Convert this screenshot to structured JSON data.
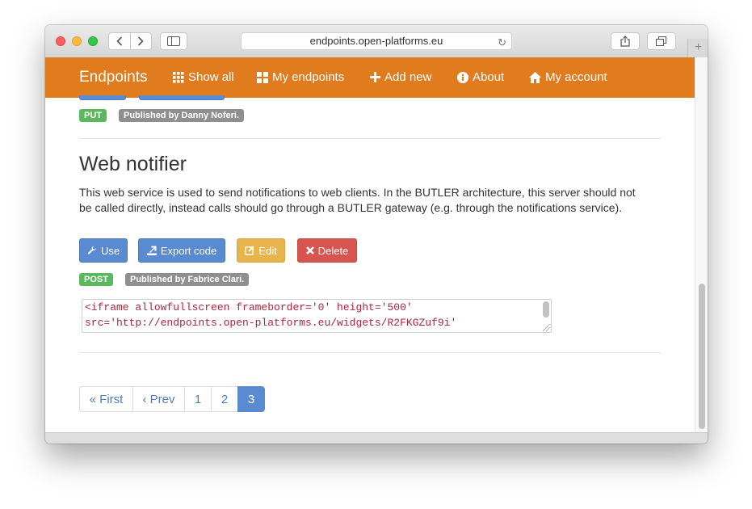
{
  "browser": {
    "url": "endpoints.open-platforms.eu",
    "icons": {
      "back": "chevron-left-icon",
      "forward": "chevron-right-icon",
      "sidebar": "sidebar-icon",
      "reload": "reload-icon",
      "share": "share-icon",
      "tabs": "tabs-icon",
      "new_tab": "plus-icon"
    }
  },
  "navbar": {
    "brand": "Endpoints",
    "items": [
      {
        "label": "Show all",
        "icon": "grid-icon"
      },
      {
        "label": "My endpoints",
        "icon": "th-large-icon"
      },
      {
        "label": "Add new",
        "icon": "plus-icon"
      },
      {
        "label": "About",
        "icon": "info-icon"
      },
      {
        "label": "My account",
        "icon": "home-icon"
      }
    ],
    "color": "#e07b1e"
  },
  "previous_entry": {
    "method": "PUT",
    "publisher": "Published by Danny Noferi."
  },
  "entry": {
    "title": "Web notifier",
    "description": "This web service is used to send notifications to web clients. In the BUTLER architecture, this server should not be called directly, instead calls should go through a BUTLER gateway (e.g. through the notifications service).",
    "buttons": {
      "use": "Use",
      "export": "Export code",
      "edit": "Edit",
      "delete": "Delete"
    },
    "method": "POST",
    "publisher": "Published by Fabrice Clari.",
    "embed_code": [
      "<iframe allowfullscreen frameborder='0' height='500'",
      "src='http://endpoints.open-platforms.eu/widgets/R2FKGZuf9i'"
    ]
  },
  "pagination": {
    "first": "« First",
    "prev": "‹ Prev",
    "pages": [
      "1",
      "2",
      "3"
    ],
    "current": "3"
  }
}
